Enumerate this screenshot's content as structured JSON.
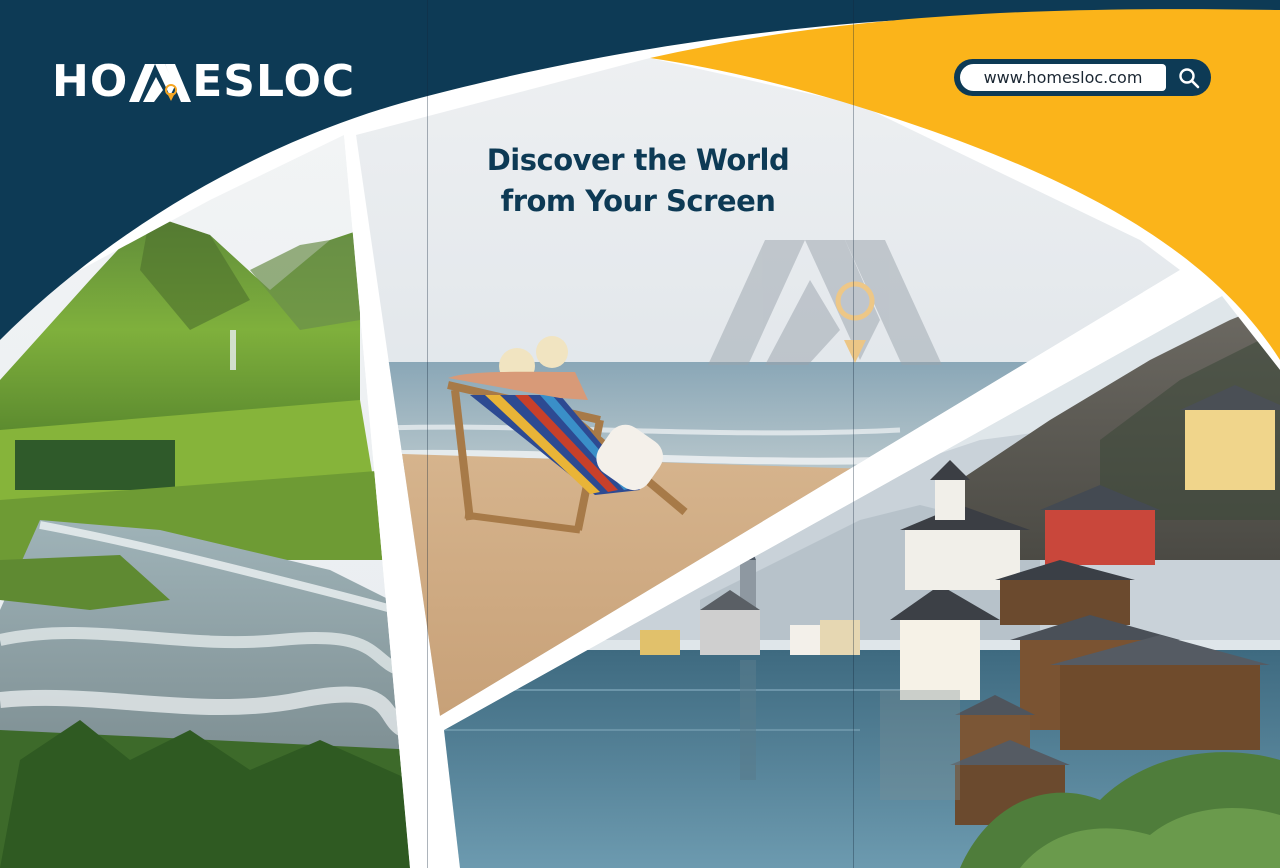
{
  "brand": {
    "name": "HOMESLOC",
    "logo_prefix": "HO",
    "logo_suffix": "ESLOC"
  },
  "header": {
    "url": "www.homesloc.com",
    "search_icon": "search-icon"
  },
  "headline": {
    "line1": "Discover the World",
    "line2": "from Your Screen"
  },
  "photos": [
    {
      "name": "mountain-river-photo"
    },
    {
      "name": "beach-deckchair-photo"
    },
    {
      "name": "lakeside-village-photo"
    }
  ],
  "colors": {
    "navy": "#0d3a55",
    "yellow": "#fbb41a",
    "white": "#ffffff",
    "pin": "#f6a623"
  }
}
